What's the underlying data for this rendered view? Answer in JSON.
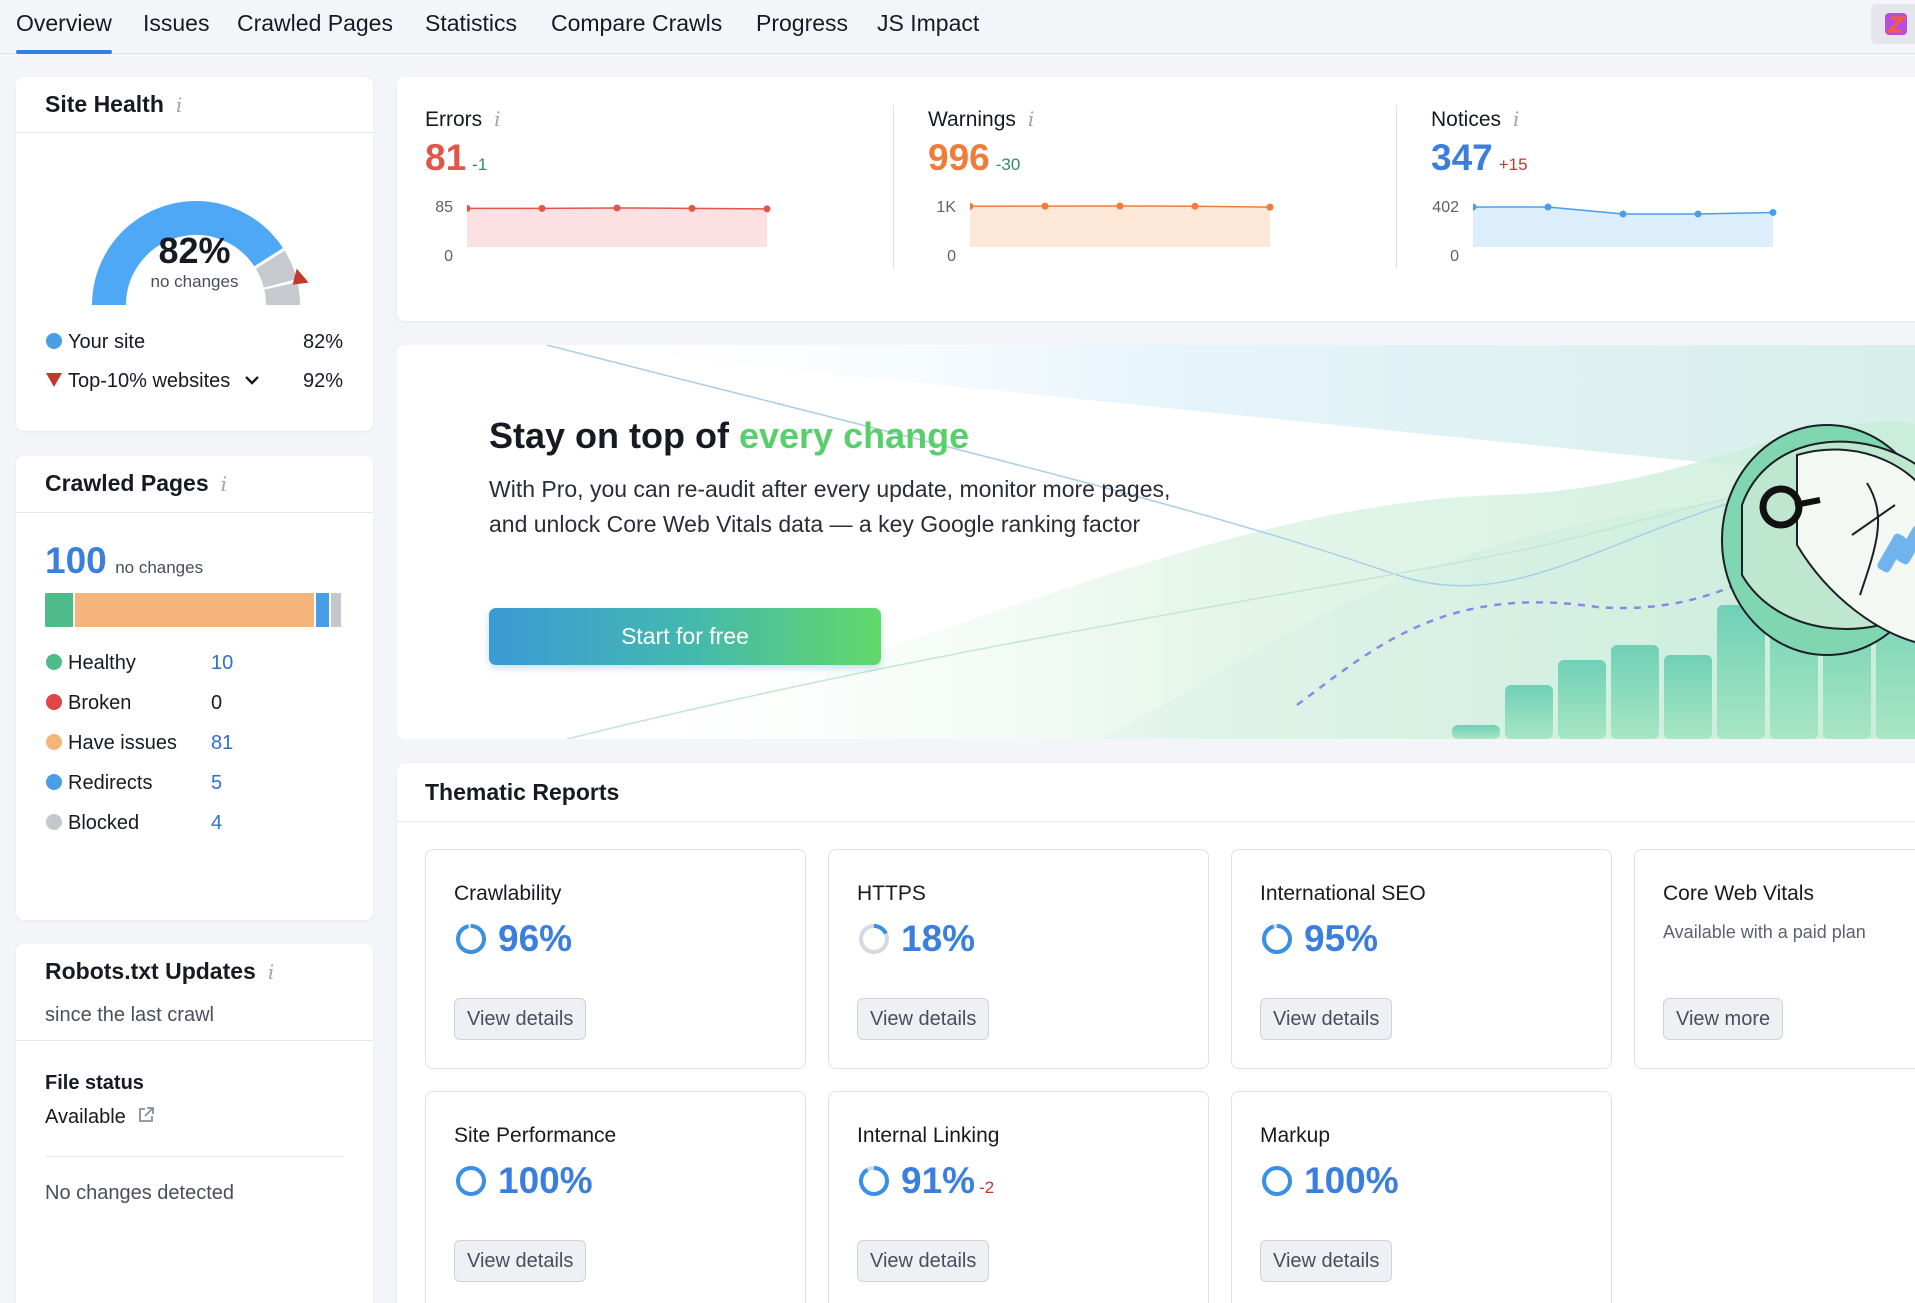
{
  "tabs": [
    {
      "label": "Overview"
    },
    {
      "label": "Issues"
    },
    {
      "label": "Crawled Pages"
    },
    {
      "label": "Statistics"
    },
    {
      "label": "Compare Crawls"
    },
    {
      "label": "Progress"
    },
    {
      "label": "JS Impact"
    }
  ],
  "colors": {
    "accent": "#2f7fe6",
    "errors": "#e0574a",
    "warnings": "#f07c3a",
    "notices": "#3a7fde",
    "healthy": "#4fba8a",
    "broken": "#e04646",
    "have_issues": "#f5b57a",
    "redirects": "#4a9ee8",
    "blocked": "#c4c7ce",
    "promo_accent": "#59cf6b"
  },
  "site_health": {
    "title": "Site Health",
    "score": "82%",
    "score_value": 82,
    "top10_value": 92,
    "status": "no changes",
    "legend": [
      {
        "label": "Your site",
        "value": "82%"
      },
      {
        "label": "Top-10% websites",
        "value": "92%"
      }
    ]
  },
  "crawled_pages": {
    "title": "Crawled Pages",
    "total": "100",
    "status": "no changes",
    "items": [
      {
        "label": "Healthy",
        "value": "10",
        "count": 10
      },
      {
        "label": "Broken",
        "value": "0",
        "count": 0
      },
      {
        "label": "Have issues",
        "value": "81",
        "count": 81
      },
      {
        "label": "Redirects",
        "value": "5",
        "count": 5
      },
      {
        "label": "Blocked",
        "value": "4",
        "count": 4
      }
    ]
  },
  "robots": {
    "title": "Robots.txt Updates",
    "subtitle": "since the last crawl",
    "file_status_label": "File status",
    "file_status_value": "Available",
    "changes": "No changes detected"
  },
  "issues": {
    "errors": {
      "label": "Errors",
      "value": "81",
      "delta": "-1",
      "ymax": "85",
      "ymin": "0",
      "ymax_num": 85,
      "points": [
        82,
        82,
        83,
        82,
        81
      ]
    },
    "warnings": {
      "label": "Warnings",
      "value": "996",
      "delta": "-30",
      "ymax": "1K",
      "ymin": "0",
      "ymax_num": 1000,
      "points": [
        1020,
        1022,
        1025,
        1020,
        996
      ]
    },
    "notices": {
      "label": "Notices",
      "value": "347",
      "delta": "+15",
      "ymax": "402",
      "ymin": "0",
      "ymax_num": 402,
      "points": [
        402,
        402,
        332,
        332,
        347
      ]
    }
  },
  "promo": {
    "title_prefix": "Stay on top of ",
    "title_accent": "every change",
    "text": "With Pro, you can re-audit after every update, monitor more pages, and unlock Core Web Vitals data — a key Google ranking factor",
    "button": "Start for free"
  },
  "thematic": {
    "title": "Thematic Reports",
    "reports": [
      {
        "name": "Crawlability",
        "pct": "96%",
        "value": 96,
        "button": "View details"
      },
      {
        "name": "HTTPS",
        "pct": "18%",
        "value": 18,
        "button": "View details"
      },
      {
        "name": "International SEO",
        "pct": "95%",
        "value": 95,
        "button": "View details"
      },
      {
        "name": "Core Web Vitals",
        "sub": "Available with a paid plan",
        "button": "View more"
      },
      {
        "name": "Site Performance",
        "pct": "100%",
        "value": 100,
        "button": "View details"
      },
      {
        "name": "Internal Linking",
        "pct": "91%",
        "value": 91,
        "delta": "-2",
        "button": "View details"
      },
      {
        "name": "Markup",
        "pct": "100%",
        "value": 100,
        "button": "View details"
      }
    ]
  }
}
